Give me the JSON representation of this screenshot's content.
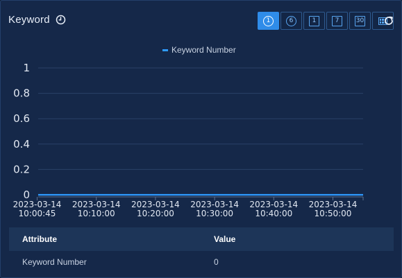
{
  "header": {
    "title": "Keyword"
  },
  "time_range_buttons": [
    {
      "label": "1",
      "icon": "circle-1-icon",
      "active": true
    },
    {
      "label": "6",
      "icon": "circle-6-icon",
      "active": false
    },
    {
      "label": "1",
      "icon": "square-1-icon",
      "active": false
    },
    {
      "label": "7",
      "icon": "square-7-icon",
      "active": false
    },
    {
      "label": "30",
      "icon": "square-30-icon",
      "active": false
    },
    {
      "label": "",
      "icon": "calendar-grid-icon",
      "active": false
    }
  ],
  "colors": {
    "accent": "#2f8ce9",
    "series": "#2f9bff",
    "panel_bg": "#152849"
  },
  "chart_data": {
    "type": "line",
    "title": "",
    "xlabel": "",
    "ylabel": "",
    "ylim": [
      0,
      1
    ],
    "yticks": [
      "1",
      "0.8",
      "0.6",
      "0.4",
      "0.2",
      "0"
    ],
    "x_tick_labels": [
      {
        "date": "2023-03-14",
        "time": "10:00:45"
      },
      {
        "date": "2023-03-14",
        "time": "10:10:00"
      },
      {
        "date": "2023-03-14",
        "time": "10:20:00"
      },
      {
        "date": "2023-03-14",
        "time": "10:30:00"
      },
      {
        "date": "2023-03-14",
        "time": "10:40:00"
      },
      {
        "date": "2023-03-14",
        "time": "10:50:00"
      }
    ],
    "x": [
      "10:00:45",
      "10:59:00"
    ],
    "series": [
      {
        "name": "Keyword Number",
        "values": [
          0,
          0
        ]
      }
    ],
    "legend": "top-center",
    "grid": true
  },
  "table": {
    "headers": [
      "Attribute",
      "Value"
    ],
    "rows": [
      [
        "Keyword Number",
        "0"
      ]
    ]
  }
}
